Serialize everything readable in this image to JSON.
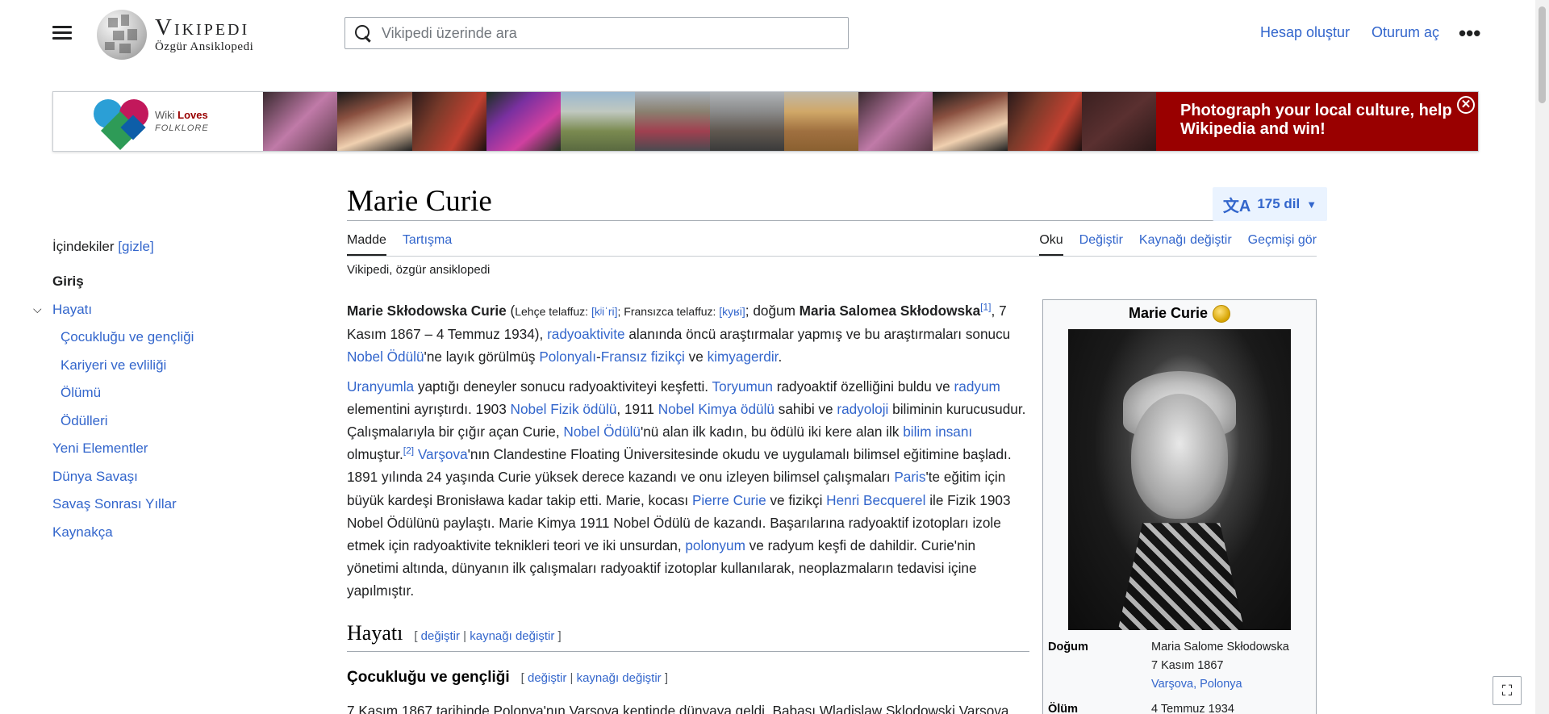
{
  "header": {
    "wordmark": "Vikipedi",
    "tagline": "Özgür Ansiklopedi",
    "search_placeholder": "Vikipedi üzerinde ara",
    "create_account": "Hesap oluştur",
    "login": "Oturum aç",
    "more": "•••"
  },
  "banner": {
    "logo_line1_a": "Wiki ",
    "logo_line1_b": "Loves",
    "logo_line2": "FOLKLORE",
    "cta": "Photograph your local culture, help Wikipedia and win!",
    "close": "✕"
  },
  "toc": {
    "title": "İçindekiler",
    "toggle": "[gizle]",
    "items": [
      {
        "label": "Giriş"
      },
      {
        "label": "Hayatı"
      },
      {
        "label": "Çocukluğu ve gençliği"
      },
      {
        "label": "Kariyeri ve evliliği"
      },
      {
        "label": "Ölümü"
      },
      {
        "label": "Ödülleri"
      },
      {
        "label": "Yeni Elementler"
      },
      {
        "label": "Dünya Savaşı"
      },
      {
        "label": "Savaş Sonrası Yıllar"
      },
      {
        "label": "Kaynakça"
      }
    ]
  },
  "article": {
    "title": "Marie Curie",
    "languages": "175 dil",
    "tabs_left": [
      "Madde",
      "Tartışma"
    ],
    "tabs_right": [
      "Oku",
      "Değiştir",
      "Kaynağı değiştir",
      "Geçmişi gör"
    ],
    "tagline": "Vikipedi, özgür ansiklopedi",
    "section_hayati": "Hayatı",
    "section_cocuklugu": "Çocukluğu ve gençliği",
    "edit": "değiştir",
    "edit_source": "kaynağı değiştir",
    "trailing_text": "7 Kasım 1867 tarihinde Polonya'nın Varşova kentinde dünyaya geldi. Babası Wladislaw Sklodowski Varşova"
  },
  "infobox": {
    "title": "Marie Curie",
    "rows": [
      {
        "key": "Doğum",
        "v1": "Maria Salome Skłodowska",
        "v2": "7 Kasım 1867",
        "v3": "Varşova, Polonya"
      },
      {
        "key": "Ölüm",
        "v1": "4 Temmuz 1934"
      }
    ]
  },
  "ui": {
    "fullscreen": "⛶"
  }
}
